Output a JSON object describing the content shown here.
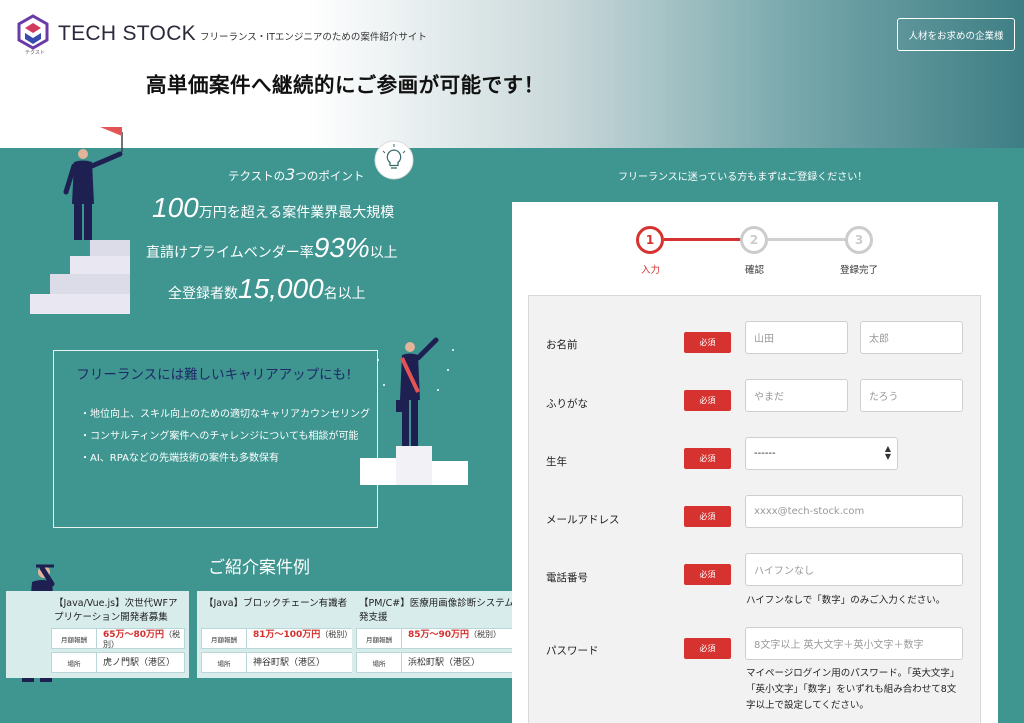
{
  "header": {
    "logo_text": "TECH STOCK",
    "logo_sub": "テクスト",
    "tagline": "フリーランス・ITエンジニアのための案件紹介サイト",
    "corp_button": "人材をお求めの企業様",
    "headline": "高単価案件へ継続的にご参画が可能です！"
  },
  "points": {
    "title_pre": "テクストの",
    "title_num": "3",
    "title_post": "つのポイント",
    "stats": [
      {
        "num": "100",
        "text": "万円を超える案件業界最大規模"
      },
      {
        "pre": "直請けプライムベンダー率",
        "num": "93%",
        "post": "以上"
      },
      {
        "pre": "全登録者数",
        "num": "15,000",
        "post": "名以上"
      }
    ]
  },
  "career": {
    "title": "フリーランスには難しいキャリアアップにも!",
    "items": [
      "・地位向上、スキル向上のための適切なキャリアカウンセリング",
      "・コンサルティング案件へのチャレンジについても相談が可能",
      "・AI、RPAなどの先端技術の案件も多数保有"
    ]
  },
  "examples": {
    "title": "ご紹介案件例",
    "fee_label": "月額報酬",
    "place_label": "場所",
    "cards": [
      {
        "title": "【Java/Vue.js】次世代WFアプリケーション開発者募集",
        "fee": "65万〜80万円",
        "fee_note": "（税別）",
        "place": "虎ノ門駅（港区）"
      },
      {
        "title": "【Java】ブロックチェーン有識者",
        "fee": "81万〜100万円",
        "fee_note": "（税別）",
        "place": "神谷町駅（港区）"
      },
      {
        "title": "【PM/C#】医療用画像診断システム開発支援",
        "fee": "85万〜90万円",
        "fee_note": "（税別）",
        "place": "浜松町駅（港区）"
      }
    ]
  },
  "register": {
    "note": "フリーランスに迷っている方もまずはご登録ください！",
    "steps": [
      {
        "num": "1",
        "label": "入力"
      },
      {
        "num": "2",
        "label": "確認"
      },
      {
        "num": "3",
        "label": "登録完了"
      }
    ],
    "required": "必須",
    "fields": {
      "name_label": "お名前",
      "last_name_ph": "山田",
      "first_name_ph": "太郎",
      "kana_label": "ふりがな",
      "last_kana_ph": "やまだ",
      "first_kana_ph": "たろう",
      "birth_label": "生年",
      "birth_value": "------",
      "email_label": "メールアドレス",
      "email_ph": "xxxx@tech-stock.com",
      "phone_label": "電話番号",
      "phone_ph": "ハイフンなし",
      "phone_help": "ハイフンなしで「数字」のみご入力ください。",
      "password_label": "パスワード",
      "password_ph": "8文字以上 英大文字＋英小文字＋数字",
      "password_help": "マイページログイン用のパスワード。「英大文字」「英小文字」「数字」をいずれも組み合わせて8文字以上で設定してください。"
    }
  },
  "colors": {
    "teal": "#3f9590",
    "accent_red": "#d63330",
    "navy": "#1e2a66"
  }
}
